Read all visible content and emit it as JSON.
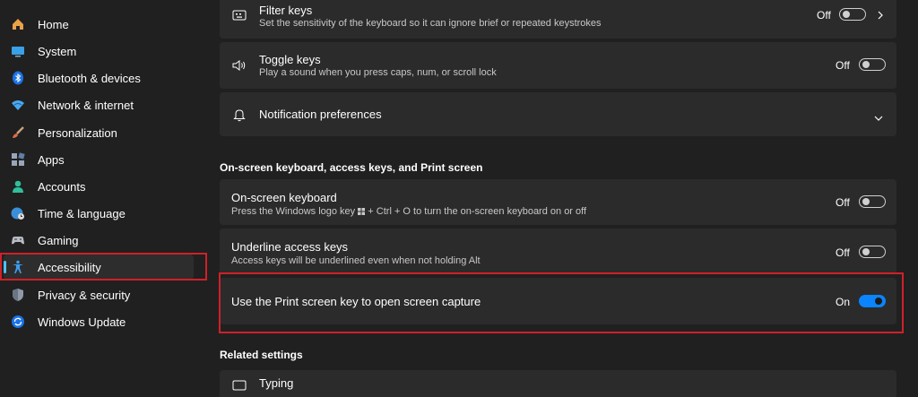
{
  "sidebar": {
    "items": [
      {
        "label": "Home",
        "icon": "home-icon"
      },
      {
        "label": "System",
        "icon": "monitor-icon"
      },
      {
        "label": "Bluetooth & devices",
        "icon": "bluetooth-icon"
      },
      {
        "label": "Network & internet",
        "icon": "wifi-icon"
      },
      {
        "label": "Personalization",
        "icon": "brush-icon"
      },
      {
        "label": "Apps",
        "icon": "apps-icon"
      },
      {
        "label": "Accounts",
        "icon": "person-icon"
      },
      {
        "label": "Time & language",
        "icon": "globe-clock-icon"
      },
      {
        "label": "Gaming",
        "icon": "gamepad-icon"
      },
      {
        "label": "Accessibility",
        "icon": "accessibility-icon"
      },
      {
        "label": "Privacy & security",
        "icon": "shield-icon"
      },
      {
        "label": "Windows Update",
        "icon": "update-icon"
      }
    ],
    "active": "Accessibility"
  },
  "cards": {
    "filter_keys": {
      "title": "Filter keys",
      "desc": "Set the sensitivity of the keyboard so it can ignore brief or repeated keystrokes",
      "state": "Off",
      "icon": "keyboard-filter-icon"
    },
    "toggle_keys": {
      "title": "Toggle keys",
      "desc": "Play a sound when you press caps, num, or scroll lock",
      "state": "Off",
      "icon": "speaker-icon"
    },
    "notifications": {
      "title": "Notification preferences",
      "icon": "bell-icon"
    },
    "onscreen_keyboard": {
      "title": "On-screen keyboard",
      "desc_prefix": "Press the Windows logo key",
      "desc_suffix": "+ Ctrl + O to turn the on-screen keyboard on or off",
      "state": "Off"
    },
    "underline_keys": {
      "title": "Underline access keys",
      "desc": "Access keys will be underlined even when not holding Alt",
      "state": "Off"
    },
    "print_screen": {
      "title": "Use the Print screen key to open screen capture",
      "state": "On"
    },
    "typing": {
      "title": "Typing"
    }
  },
  "sections": {
    "keyboard_section": "On-screen keyboard, access keys, and Print screen",
    "related": "Related settings"
  },
  "colors": {
    "accent": "#0a84ff",
    "highlight": "#d0202a",
    "background": "#202020",
    "card": "#2b2b2b"
  }
}
